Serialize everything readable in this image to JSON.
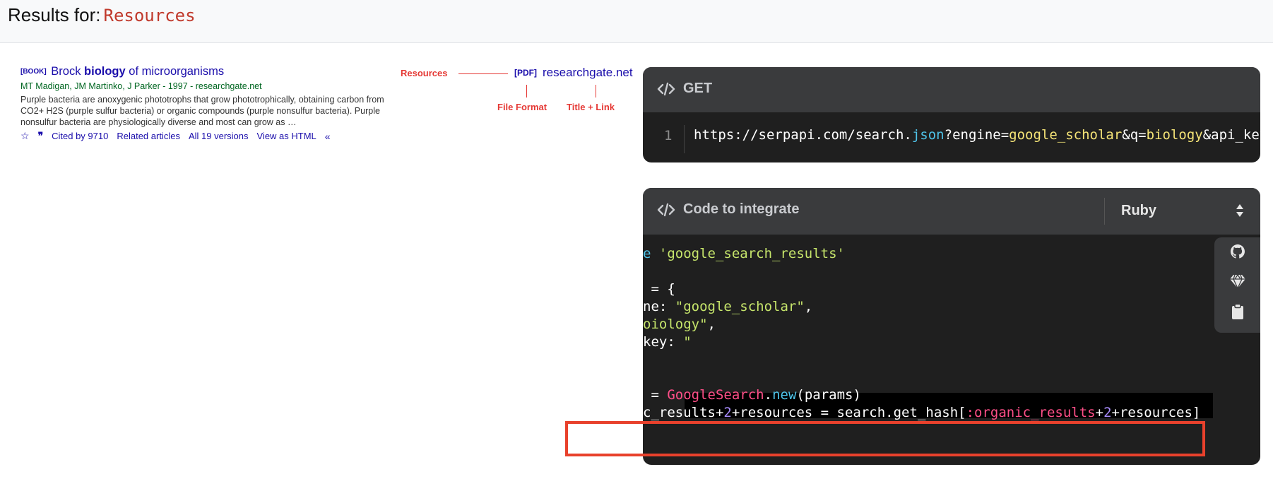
{
  "header": {
    "prefix": "Results for:",
    "query": "Resources"
  },
  "result": {
    "type_badge": "[BOOK]",
    "title_parts": [
      "Brock ",
      "biology",
      " of microorganisms"
    ],
    "authors_line": "MT Madigan, JM Martinko, J Parker - 1997 - researchgate.net",
    "snippet": "Purple bacteria are anoxygenic phototrophs that grow phototrophically, obtaining carbon from CO2+ H2S (purple sulfur bacteria) or organic compounds (purple nonsulfur bacteria). Purple nonsulfur bacteria are physiologically diverse and most can grow as …",
    "links": [
      "Cited by 9710",
      "Related articles",
      "All 19 versions",
      "View as HTML"
    ]
  },
  "annotation": {
    "resources_label": "Resources",
    "pdf_badge": "[PDF]",
    "link_text": "researchgate.net",
    "file_format_label": "File Format",
    "title_link_label": "Title + Link"
  },
  "get_panel": {
    "title": "GET",
    "line_number": "1",
    "url_parts": [
      "https://serpapi.com/search.",
      "json",
      "?engine=",
      "google_scholar",
      "&q=",
      "biology",
      "&api_key"
    ]
  },
  "code_panel": {
    "title": "Code to integrate",
    "language": "Ruby",
    "lines": {
      "l1a": "e ",
      "l1b": "'google_search_results'",
      "l2": " = {",
      "l3a": "ne: ",
      "l3b": "\"google_scholar\"",
      "l3c": ",",
      "l4a": "oiology\"",
      "l4b": ",",
      "l5a": "key: ",
      "l5b": "\"",
      "l6a": " = ",
      "l6b": "GoogleSearch",
      "l6c": ".",
      "l6d": "new",
      "l6e": "(params)",
      "l7a": "c_results+",
      "l7b": "2",
      "l7c": "+resources = search.get_hash[",
      "l7d": ":organic_results",
      "l7e": "+",
      "l7f": "2",
      "l7g": "+resources]"
    }
  },
  "icons": [
    "code-icon",
    "github-icon",
    "gem-icon",
    "clipboard-icon",
    "star-icon",
    "quote-icon",
    "chevrons-icon",
    "select-arrows-icon"
  ],
  "colors": {
    "accent_red": "#e8412c",
    "link_blue": "#1a0dab",
    "green": "#006621"
  }
}
